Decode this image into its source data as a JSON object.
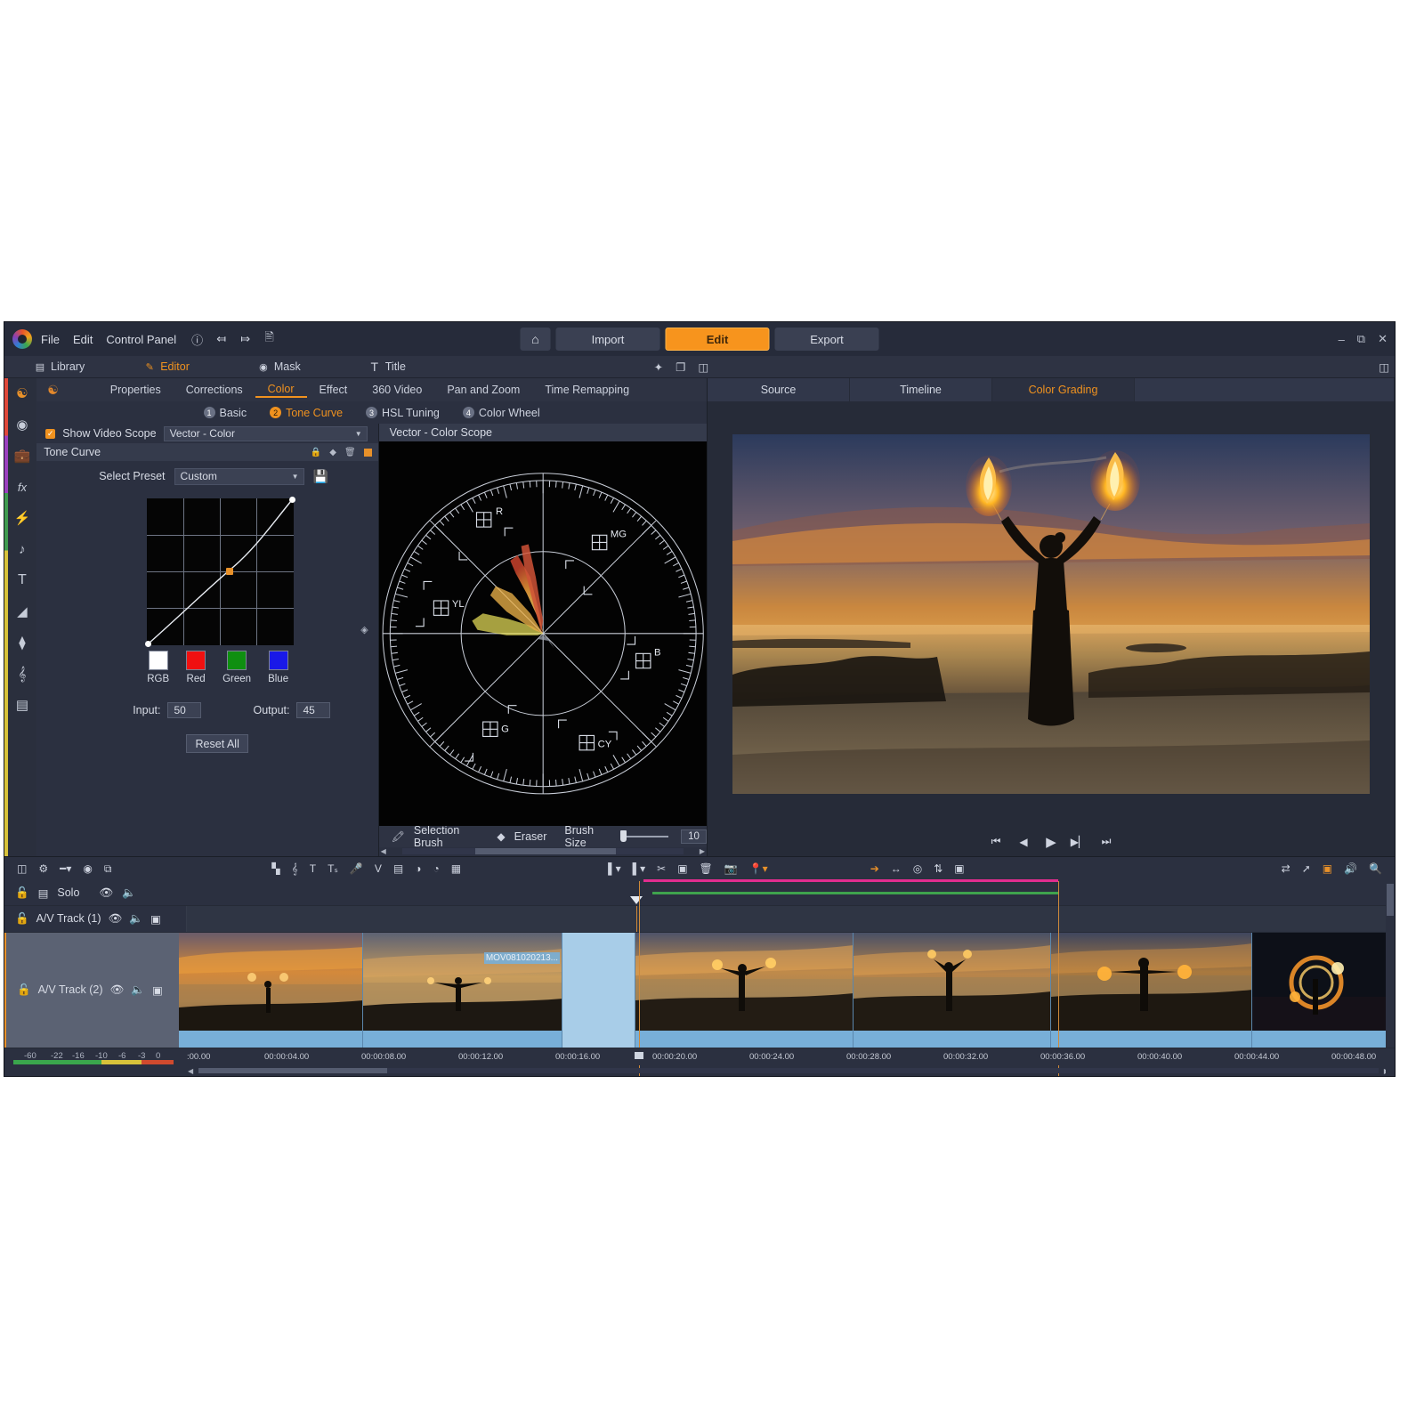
{
  "app": {
    "menu": [
      "File",
      "Edit",
      "Control Panel"
    ],
    "title_icons": [
      "help-icon",
      "undo-icon",
      "redo-icon",
      "document-icon"
    ],
    "main_buttons": [
      {
        "label": "Import",
        "active": false
      },
      {
        "label": "Edit",
        "active": true
      },
      {
        "label": "Export",
        "active": false
      }
    ],
    "home_icon": "home-icon",
    "window_controls": [
      "minimize",
      "restore",
      "close"
    ],
    "accent_color": "#f7941d"
  },
  "module_tabs": [
    {
      "label": "Library",
      "icon": "library-icon",
      "active": false
    },
    {
      "label": "Editor",
      "icon": "editor-pencil-icon",
      "active": true
    },
    {
      "label": "Mask",
      "icon": "mask-icon",
      "active": false
    },
    {
      "label": "Title",
      "icon": "title-T-icon",
      "active": false
    }
  ],
  "rail_icons": [
    "media-room-icon",
    "effect-room-icon",
    "pip-object-icon",
    "fx-icon",
    "particle-icon",
    "music-note-icon",
    "title-T-icon",
    "transition-icon",
    "layers-icon",
    "audio-clef-icon",
    "keyboard-icon"
  ],
  "feature_tabs": [
    {
      "label": "Properties",
      "active": false
    },
    {
      "label": "Corrections",
      "active": false
    },
    {
      "label": "Color",
      "active": true
    },
    {
      "label": "Effect",
      "active": false
    },
    {
      "label": "360 Video",
      "active": false
    },
    {
      "label": "Pan and Zoom",
      "active": false
    },
    {
      "label": "Time Remapping",
      "active": false
    }
  ],
  "sub_tabs": [
    {
      "num": "1",
      "label": "Basic",
      "active": false
    },
    {
      "num": "2",
      "label": "Tone Curve",
      "active": true
    },
    {
      "num": "3",
      "label": "HSL Tuning",
      "active": false
    },
    {
      "num": "4",
      "label": "Color Wheel",
      "active": false
    }
  ],
  "scope_row": {
    "checkbox_label": "Show Video Scope",
    "checked": true,
    "selected_scope": "Vector - Color"
  },
  "tone_curve": {
    "section_title": "Tone Curve",
    "section_tools": [
      "lock-icon",
      "keyframe-diamond-icon",
      "trash-icon",
      "color-square-icon"
    ],
    "preset_label": "Select Preset",
    "preset_value": "Custom",
    "save_icon": "save-disk-icon",
    "channels": [
      {
        "label": "RGB",
        "color": "#ffffff"
      },
      {
        "label": "Red",
        "color": "#f01010"
      },
      {
        "label": "Green",
        "color": "#0f8f10"
      },
      {
        "label": "Blue",
        "color": "#1919e8"
      }
    ],
    "input_label": "Input:",
    "input_value": "50",
    "output_label": "Output:",
    "output_value": "45",
    "reset_label": "Reset All"
  },
  "scope_panel": {
    "title": "Vector - Color Scope",
    "targets": [
      "R",
      "MG",
      "B",
      "CY",
      "G",
      "YL"
    ],
    "brush_bar": {
      "selection_brush": "Selection Brush",
      "eraser": "Eraser",
      "brush_size_label": "Brush Size",
      "brush_size_value": "10"
    }
  },
  "preview_tabs": [
    {
      "label": "Source",
      "active": false
    },
    {
      "label": "Timeline",
      "active": false
    },
    {
      "label": "Color Grading",
      "active": true
    }
  ],
  "playback_controls": [
    "skip-start-icon",
    "step-back-icon",
    "play-icon",
    "step-forward-icon",
    "skip-end-icon"
  ],
  "timeline": {
    "toolbar_left": [
      "track-manager-icon",
      "settings-gear-icon",
      "track-mode-icon",
      "record-icon",
      "detach-icon"
    ],
    "toolbar_mid": [
      "audio-mix-icon",
      "clef-icon",
      "title-T-icon",
      "text-to-speech-icon",
      "voice-over-icon",
      "chroma-icon",
      "storyboard-icon",
      "blend-icon",
      "mask-blend-icon",
      "paint-designer-icon"
    ],
    "toolbar_mid2": [
      "marker-in-icon",
      "marker-out-icon",
      "split-icon",
      "crop-icon",
      "trash-icon",
      "snapshot-icon",
      "marker-icon"
    ],
    "toolbar_mid3": [
      "pointer-icon",
      "trim-icon",
      "fix-icon",
      "multi-trim-icon",
      "thumbnail-icon"
    ],
    "toolbar_right": [
      "fit-icon",
      "magnet-icon",
      "marker-color-icon",
      "audio-icon",
      "zoom-icon"
    ],
    "master_track": {
      "label": "Solo",
      "icons": [
        "lock-icon",
        "track-icon",
        "eye-icon",
        "speaker-icon"
      ]
    },
    "tracks": [
      {
        "label": "A/V Track (1)",
        "icons": [
          "lock-icon",
          "eye-icon",
          "speaker-icon",
          "thumb-icon"
        ]
      },
      {
        "label": "A/V Track (2)",
        "icons": [
          "lock-icon",
          "eye-icon",
          "speaker-icon",
          "thumb-icon"
        ]
      }
    ],
    "selected_clip_label": "MOV081020213...",
    "ruler_ticks": [
      ":00.00",
      "00:00:04.00",
      "00:00:08.00",
      "00:00:12.00",
      "00:00:16.00",
      "00:00:20.00",
      "00:00:24.00",
      "00:00:28.00",
      "00:00:32.00",
      "00:00:36.00",
      "00:00:40.00",
      "00:00:44.00",
      "00:00:48.00"
    ],
    "audio_meter_scale": [
      "-60",
      "-22",
      "-16",
      "-10",
      "-6",
      "-3",
      "0"
    ]
  }
}
